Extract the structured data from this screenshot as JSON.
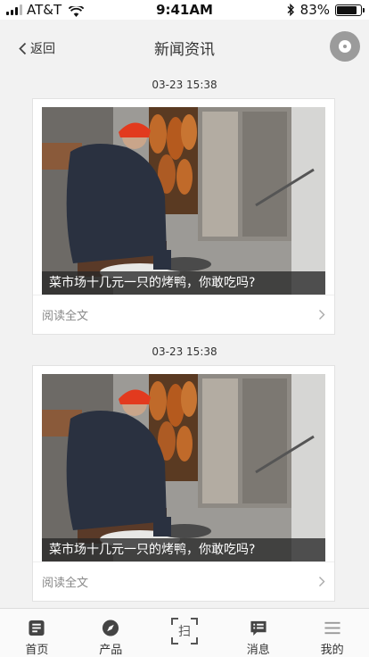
{
  "status_bar": {
    "carrier": "AT&T",
    "time": "9:41AM",
    "battery_percent": "83%",
    "battery_level": 0.83
  },
  "nav": {
    "back_label": "返回",
    "title": "新闻资讯",
    "right_icon": "record-icon"
  },
  "news": [
    {
      "time": "03-23 15:38",
      "caption": "菜市场十几元一只的烤鸭，你敢吃吗?",
      "read_more": "阅读全文"
    },
    {
      "time": "03-23 15:38",
      "caption": "菜市场十几元一只的烤鸭，你敢吃吗?",
      "read_more": "阅读全文"
    }
  ],
  "tabs": [
    {
      "label": "首页",
      "icon": "document-icon"
    },
    {
      "label": "产品",
      "icon": "compass-icon"
    },
    {
      "label": "扫",
      "icon": "scan-icon"
    },
    {
      "label": "消息",
      "icon": "message-icon"
    },
    {
      "label": "我的",
      "icon": "menu-icon"
    }
  ],
  "colors": {
    "background": "#f2f2f2",
    "card": "#ffffff",
    "caption_overlay": "#282828",
    "text": "#333333",
    "muted": "#888888"
  }
}
